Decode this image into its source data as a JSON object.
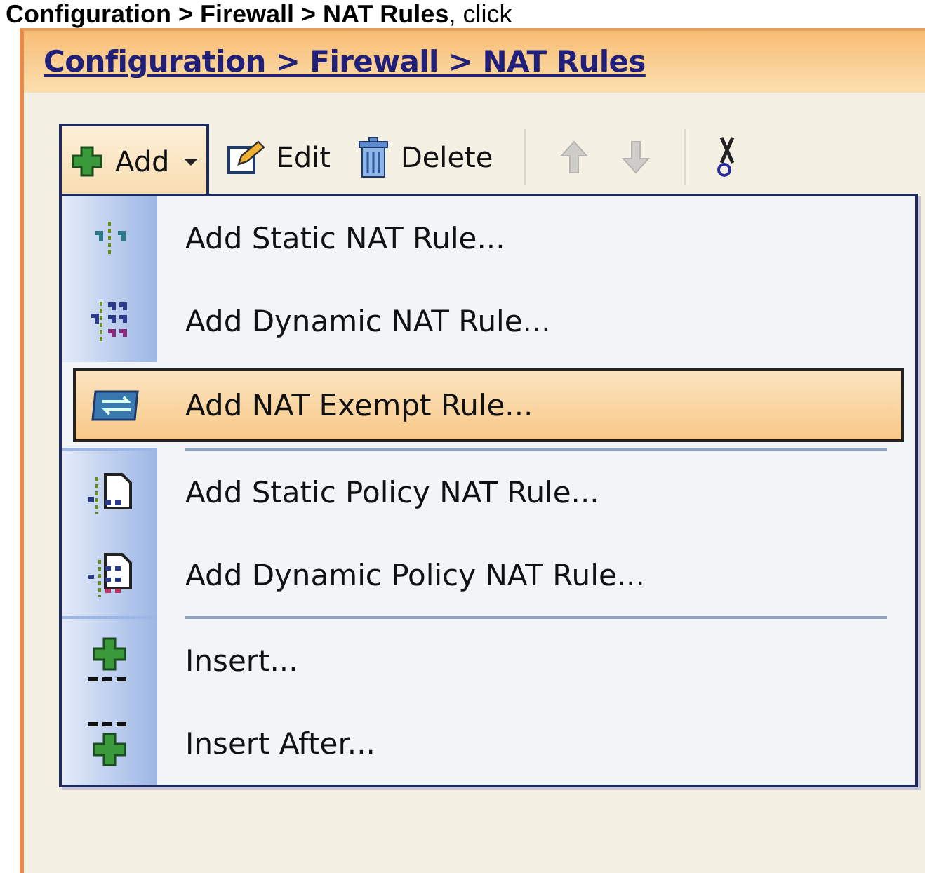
{
  "caption": "**Configuration > Firewall > NAT Rules**, click",
  "breadcrumb": "Configuration > Firewall > NAT Rules",
  "toolbar": [
    {
      "kind": "add",
      "label": "Add",
      "expanded": true,
      "disabled": false
    },
    {
      "kind": "edit",
      "label": "Edit",
      "disabled": false
    },
    {
      "kind": "delete",
      "label": "Delete",
      "disabled": false
    },
    {
      "kind": "up",
      "disabled": true
    },
    {
      "kind": "down",
      "disabled": true
    },
    {
      "kind": "cut",
      "disabled": false
    }
  ],
  "menu": {
    "items": [
      {
        "kind": "static",
        "label": "Add Static NAT Rule...",
        "selected": false,
        "separator_after": false
      },
      {
        "kind": "dynamic",
        "label": "Add Dynamic NAT Rule...",
        "selected": false,
        "separator_after": false
      },
      {
        "kind": "exempt",
        "label": "Add NAT Exempt Rule...",
        "selected": true,
        "separator_after": true
      },
      {
        "kind": "static_policy",
        "label": "Add Static Policy NAT Rule...",
        "selected": false,
        "separator_after": false
      },
      {
        "kind": "dynamic_policy",
        "label": "Add Dynamic Policy NAT Rule...",
        "selected": false,
        "separator_after": true
      },
      {
        "kind": "insert",
        "label": "Insert...",
        "selected": false,
        "separator_after": false
      },
      {
        "kind": "insert_after",
        "label": "Insert After...",
        "selected": false,
        "separator_after": false
      }
    ]
  }
}
